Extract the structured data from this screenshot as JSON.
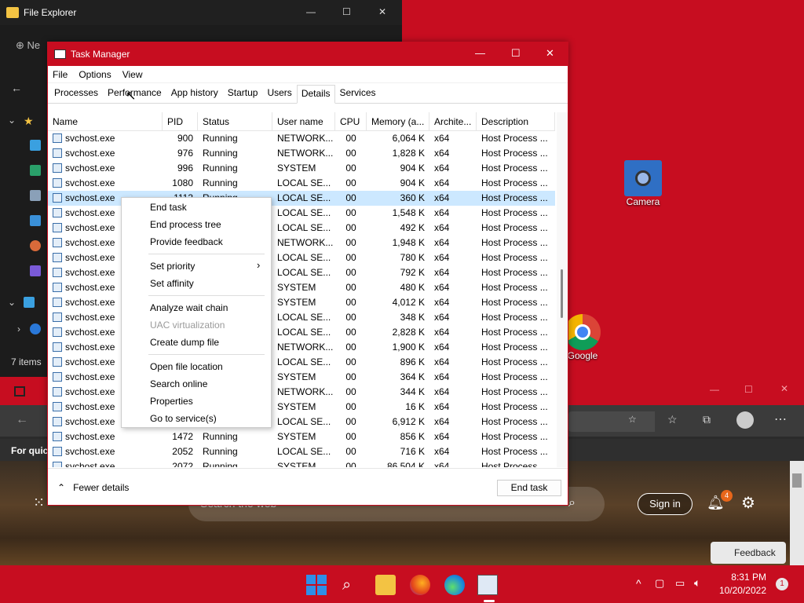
{
  "file_explorer": {
    "title": "File Explorer",
    "items_count": "7 items",
    "new_label": "Ne"
  },
  "desktop": {
    "camera_label": "Camera",
    "chrome_label": "Google Chrome"
  },
  "edge": {
    "favorites_text": "For quic",
    "search_placeholder": "Search the web",
    "sign_in": "Sign in",
    "notif_count": "4",
    "feedback": "Feedback"
  },
  "task_manager": {
    "title": "Task Manager",
    "menu": [
      "File",
      "Options",
      "View"
    ],
    "tabs": [
      "Processes",
      "Performance",
      "App history",
      "Startup",
      "Users",
      "Details",
      "Services"
    ],
    "active_tab": "Details",
    "columns": [
      "Name",
      "PID",
      "Status",
      "User name",
      "CPU",
      "Memory (a...",
      "Archite...",
      "Description"
    ],
    "rows": [
      [
        "svchost.exe",
        "900",
        "Running",
        "NETWORK...",
        "00",
        "6,064 K",
        "x64",
        "Host Process ..."
      ],
      [
        "svchost.exe",
        "976",
        "Running",
        "NETWORK...",
        "00",
        "1,828 K",
        "x64",
        "Host Process ..."
      ],
      [
        "svchost.exe",
        "996",
        "Running",
        "SYSTEM",
        "00",
        "904 K",
        "x64",
        "Host Process ..."
      ],
      [
        "svchost.exe",
        "1080",
        "Running",
        "LOCAL SE...",
        "00",
        "904 K",
        "x64",
        "Host Process ..."
      ],
      [
        "svchost.exe",
        "1113",
        "Running",
        "LOCAL SE...",
        "00",
        "360 K",
        "x64",
        "Host Process ..."
      ],
      [
        "svchost.exe",
        "",
        "",
        "LOCAL SE...",
        "00",
        "1,548 K",
        "x64",
        "Host Process ..."
      ],
      [
        "svchost.exe",
        "",
        "",
        "LOCAL SE...",
        "00",
        "492 K",
        "x64",
        "Host Process ..."
      ],
      [
        "svchost.exe",
        "",
        "",
        "NETWORK...",
        "00",
        "1,948 K",
        "x64",
        "Host Process ..."
      ],
      [
        "svchost.exe",
        "",
        "",
        "LOCAL SE...",
        "00",
        "780 K",
        "x64",
        "Host Process ..."
      ],
      [
        "svchost.exe",
        "",
        "",
        "LOCAL SE...",
        "00",
        "792 K",
        "x64",
        "Host Process ..."
      ],
      [
        "svchost.exe",
        "",
        "",
        "SYSTEM",
        "00",
        "480 K",
        "x64",
        "Host Process ..."
      ],
      [
        "svchost.exe",
        "",
        "",
        "SYSTEM",
        "00",
        "4,012 K",
        "x64",
        "Host Process ..."
      ],
      [
        "svchost.exe",
        "",
        "",
        "LOCAL SE...",
        "00",
        "348 K",
        "x64",
        "Host Process ..."
      ],
      [
        "svchost.exe",
        "",
        "",
        "LOCAL SE...",
        "00",
        "2,828 K",
        "x64",
        "Host Process ..."
      ],
      [
        "svchost.exe",
        "",
        "",
        "NETWORK...",
        "00",
        "1,900 K",
        "x64",
        "Host Process ..."
      ],
      [
        "svchost.exe",
        "",
        "",
        "LOCAL SE...",
        "00",
        "896 K",
        "x64",
        "Host Process ..."
      ],
      [
        "svchost.exe",
        "",
        "",
        "SYSTEM",
        "00",
        "364 K",
        "x64",
        "Host Process ..."
      ],
      [
        "svchost.exe",
        "",
        "",
        "NETWORK...",
        "00",
        "344 K",
        "x64",
        "Host Process ..."
      ],
      [
        "svchost.exe",
        "",
        "",
        "SYSTEM",
        "00",
        "16 K",
        "x64",
        "Host Process ..."
      ],
      [
        "svchost.exe",
        "",
        "",
        "LOCAL SE...",
        "00",
        "6,912 K",
        "x64",
        "Host Process ..."
      ],
      [
        "svchost.exe",
        "1472",
        "Running",
        "SYSTEM",
        "00",
        "856 K",
        "x64",
        "Host Process ..."
      ],
      [
        "svchost.exe",
        "2052",
        "Running",
        "LOCAL SE...",
        "00",
        "716 K",
        "x64",
        "Host Process ..."
      ],
      [
        "svchost.exe",
        "2072",
        "Running",
        "SYSTEM",
        "00",
        "86,504 K",
        "x64",
        "Host Process ..."
      ]
    ],
    "selected_row": 4,
    "fewer_details": "Fewer details",
    "end_task_button": "End task"
  },
  "context_menu": {
    "end_task": "End task",
    "end_process_tree": "End process tree",
    "provide_feedback": "Provide feedback",
    "set_priority": "Set priority",
    "set_affinity": "Set affinity",
    "analyze_wait_chain": "Analyze wait chain",
    "uac_virtualization": "UAC virtualization",
    "create_dump_file": "Create dump file",
    "open_file_location": "Open file location",
    "search_online": "Search online",
    "properties": "Properties",
    "go_to_services": "Go to service(s)"
  },
  "taskbar": {
    "time": "8:31 PM",
    "date": "10/20/2022",
    "notifications": "1"
  },
  "colors": {
    "accent": "#c70d20",
    "selection": "#cce8ff"
  }
}
